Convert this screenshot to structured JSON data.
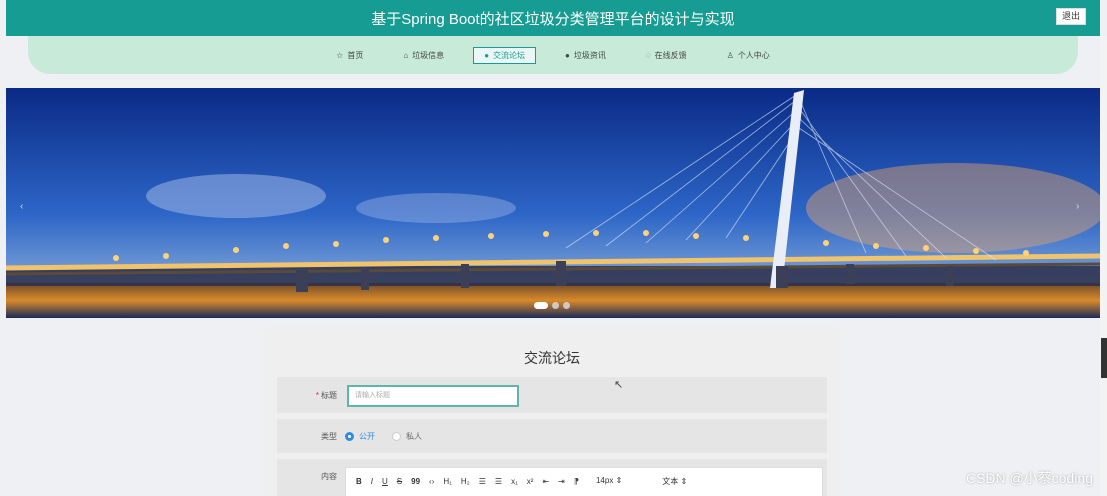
{
  "header": {
    "title": "基于Spring Boot的社区垃圾分类管理平台的设计与实现",
    "logout_label": "退出"
  },
  "nav": {
    "items": [
      {
        "icon": "☆",
        "label": "首页"
      },
      {
        "icon": "⌂",
        "label": "垃圾信息"
      },
      {
        "icon": "●",
        "label": "交流论坛"
      },
      {
        "icon": "●",
        "label": "垃圾资讯"
      },
      {
        "icon": "◌",
        "label": "在线反馈"
      },
      {
        "icon": "♙",
        "label": "个人中心"
      }
    ]
  },
  "banner": {
    "prev_icon": "‹",
    "next_icon": "›"
  },
  "form": {
    "title": "交流论坛",
    "title_field": {
      "required_mark": "*",
      "label": "标题",
      "placeholder": "请输入标题"
    },
    "type_field": {
      "label": "类型",
      "option_public": "公开",
      "option_private": "私人"
    },
    "content_field": {
      "label": "内容",
      "toolbar": {
        "bold": "B",
        "italic": "I",
        "underline": "U",
        "strike": "S",
        "quote": "99",
        "code": "‹›",
        "h1": "H₁",
        "h2": "H₂",
        "ol": "☰",
        "ul": "☰",
        "sub": "x₁",
        "sup": "x²",
        "indent_out": "⇤",
        "indent_in": "⇥",
        "direction": "⁋",
        "font_size": "14px",
        "font_size_arrow": "⇕",
        "text_type": "文本",
        "text_type_arrow": "⇕"
      }
    }
  },
  "watermark": "CSDN @小蔡coding",
  "colors": {
    "accent": "#169c92",
    "nav_bg": "#c8ebd9",
    "radio_on": "#2f8ae6"
  }
}
